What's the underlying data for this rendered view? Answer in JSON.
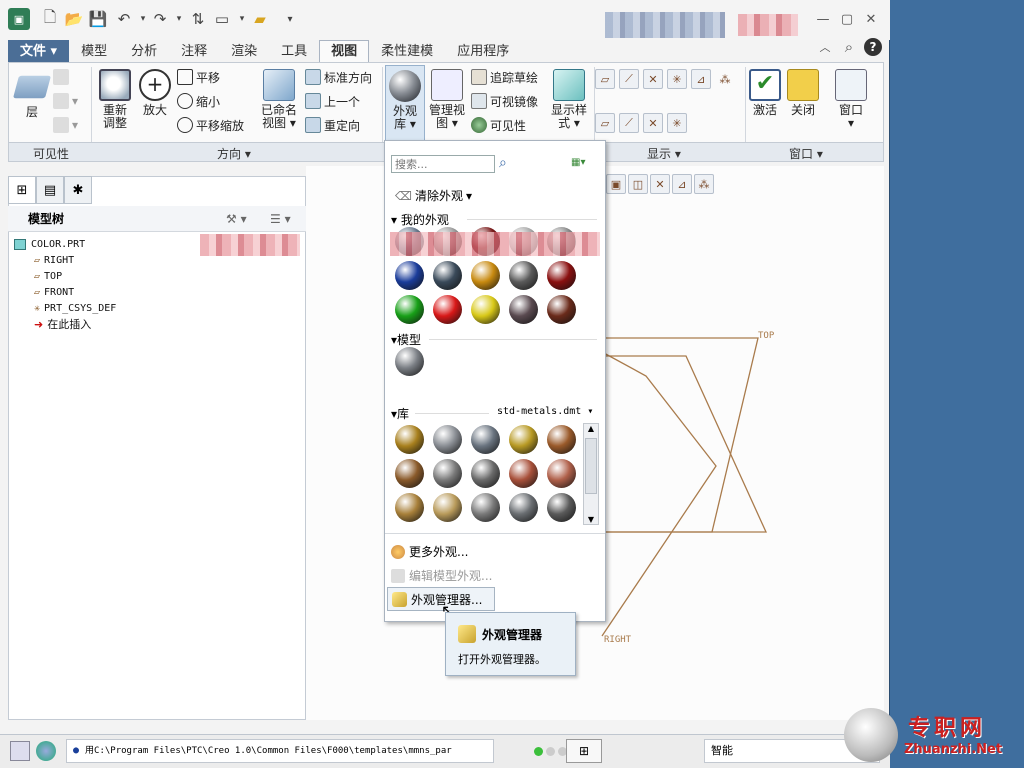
{
  "quick_access": {
    "items": [
      "new-icon",
      "open-icon",
      "save-icon",
      "undo-icon",
      "redo-icon",
      "regenerate-icon",
      "windows-icon",
      "folder-icon",
      "customize-icon"
    ]
  },
  "ribbon_tabs": [
    "文件",
    "模型",
    "分析",
    "注释",
    "渲染",
    "工具",
    "视图",
    "柔性建模",
    "应用程序"
  ],
  "ribbon": {
    "layer": "层",
    "refit_1": "重新",
    "refit_2": "调整",
    "zoom_in": "放大",
    "pan": "平移",
    "zoom_out": "缩小",
    "pan_zoom": "平移缩放",
    "named_views_1": "已命名",
    "named_views_2": "视图",
    "standard_orient": "标准方向",
    "previous": "上一个",
    "reorient": "重定向",
    "appearance_1": "外观",
    "appearance_2": "库",
    "manage_views_1": "管理视",
    "manage_views_2": "图",
    "trace_sketch": "追踪草绘",
    "visible_mirror": "可视镜像",
    "visibility": "可见性",
    "display_style_1": "显示样",
    "display_style_2": "式",
    "activate": "激活",
    "close": "关闭",
    "window": "窗口"
  },
  "group_labels": {
    "visibility": "可见性",
    "orientation": "方向",
    "display": "显示",
    "window": "窗口"
  },
  "model_tree": {
    "title": "模型树",
    "items": [
      "COLOR.PRT",
      "RIGHT",
      "TOP",
      "FRONT",
      "PRT_CSYS_DEF",
      "在此插入"
    ]
  },
  "dropdown": {
    "search_placeholder": "搜索...",
    "clear": "清除外观",
    "my_appearances": "我的外观",
    "model": "模型",
    "library": "库",
    "library_file": "std-metals.dmt",
    "more": "更多外观...",
    "edit_model": "编辑模型外观...",
    "manager": "外观管理器..."
  },
  "tooltip": {
    "title": "外观管理器",
    "desc": "打开外观管理器。"
  },
  "canvas": {
    "top_label": "TOP",
    "right_label": "RIGHT"
  },
  "status": {
    "message": "用C:\\Program Files\\PTC\\Creo 1.0\\Common Files\\F000\\templates\\mmns_par",
    "filter": "智能"
  },
  "watermark": {
    "cn": "专职网",
    "en": "Zhuanzhi.Net"
  },
  "colors": {
    "file_tab": "#4b6e96",
    "desktop": "#3f6e9e",
    "datum": "#9a6a3a"
  }
}
